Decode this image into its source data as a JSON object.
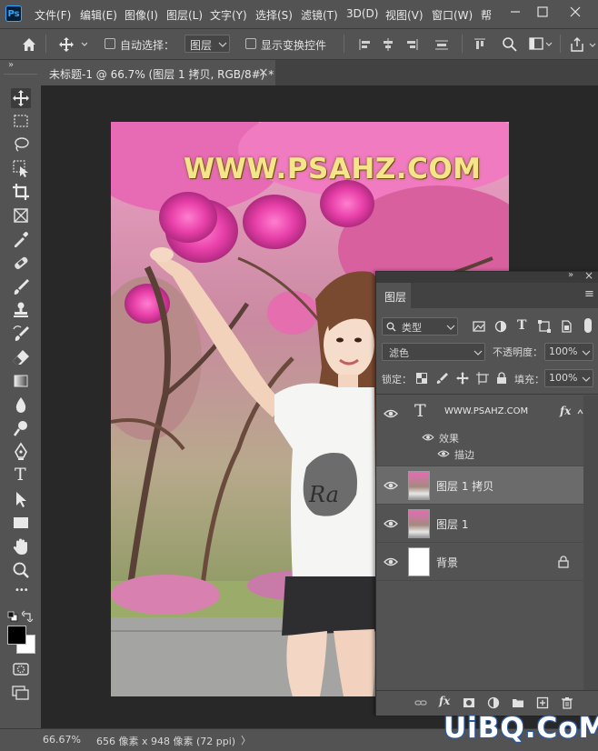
{
  "app": {
    "logo_text": "Ps"
  },
  "menu": {
    "items": [
      "文件(F)",
      "编辑(E)",
      "图像(I)",
      "图层(L)",
      "文字(Y)",
      "选择(S)",
      "滤镜(T)",
      "3D(D)",
      "视图(V)",
      "窗口(W)",
      "帮"
    ],
    "window_controls": [
      "minimize",
      "restore",
      "close"
    ]
  },
  "options_bar": {
    "auto_select_label": "自动选择：",
    "auto_select_checked": false,
    "auto_select_target": "图层",
    "show_transform_label": "显示变换控件",
    "show_transform_checked": false
  },
  "document": {
    "tab_title": "未标题-1 @ 66.7% (图层 1 拷贝, RGB/8#) *",
    "close_glyph": "×",
    "image_text": "WWW.PSAHZ.COM"
  },
  "panel_collapse_glyph": "»",
  "toolbar": {
    "tools": [
      "move-tool",
      "marquee-tool",
      "lasso-tool",
      "object-selection-tool",
      "crop-tool",
      "frame-tool",
      "eyedropper-tool",
      "healing-brush-tool",
      "brush-tool",
      "clone-stamp-tool",
      "history-brush-tool",
      "eraser-tool",
      "gradient-tool",
      "blur-tool",
      "dodge-tool",
      "pen-tool",
      "type-tool",
      "path-selection-tool",
      "rectangle-tool",
      "hand-tool",
      "zoom-tool",
      "more-tools",
      "default-colors",
      "swap-colors",
      "foreground-color",
      "background-color",
      "quick-mask-tool",
      "screen-mode-tool"
    ],
    "active_tool": "move-tool",
    "foreground_color": "#000000",
    "background_color": "#ffffff",
    "type_tool_glyph": "T",
    "more_glyph": "•••"
  },
  "layers_panel": {
    "collapse_glyph": "»",
    "close_glyph": "×",
    "tab_label": "图层",
    "menu_glyph": "≡",
    "filter_kind": "类型",
    "blend_mode": "滤色",
    "opacity_label": "不透明度：",
    "opacity_value": "100%",
    "lock_label": "锁定：",
    "fill_label": "填充：",
    "fill_value": "100%",
    "layers": [
      {
        "name": "WWW.PSAHZ.COM",
        "type": "text",
        "visible": true,
        "selected": false,
        "fx": "fx",
        "type_glyph": "T"
      },
      {
        "name": "图层 1 拷贝",
        "type": "image",
        "visible": true,
        "selected": true
      },
      {
        "name": "图层 1",
        "type": "image",
        "visible": true,
        "selected": false
      },
      {
        "name": "背景",
        "type": "background",
        "visible": true,
        "selected": false,
        "locked": true
      }
    ],
    "effects_label": "效果",
    "stroke_label": "描边"
  },
  "status_bar": {
    "zoom": "66.67%",
    "doc_info": "656 像素 x 948 像素 (72 ppi)",
    "arrow_glyph": "〉"
  },
  "site_watermark": "UiBQ.CoM"
}
